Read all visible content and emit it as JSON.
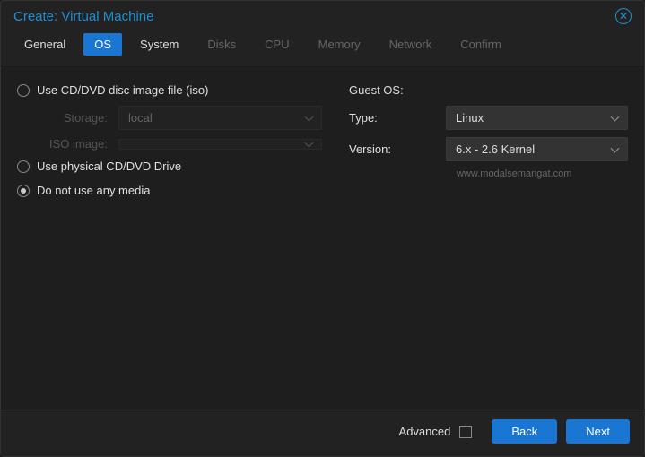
{
  "title": "Create: Virtual Machine",
  "tabs": {
    "general": "General",
    "os": "OS",
    "system": "System",
    "disks": "Disks",
    "cpu": "CPU",
    "memory": "Memory",
    "network": "Network",
    "confirm": "Confirm"
  },
  "media": {
    "iso_option": "Use CD/DVD disc image file (iso)",
    "storage_label": "Storage:",
    "storage_value": "local",
    "iso_label": "ISO image:",
    "iso_value": "",
    "physical_option": "Use physical CD/DVD Drive",
    "none_option": "Do not use any media"
  },
  "guest": {
    "header": "Guest OS:",
    "type_label": "Type:",
    "type_value": "Linux",
    "version_label": "Version:",
    "version_value": "6.x - 2.6 Kernel"
  },
  "watermark": "www.modalsemangat.com",
  "footer": {
    "advanced": "Advanced",
    "back": "Back",
    "next": "Next"
  }
}
